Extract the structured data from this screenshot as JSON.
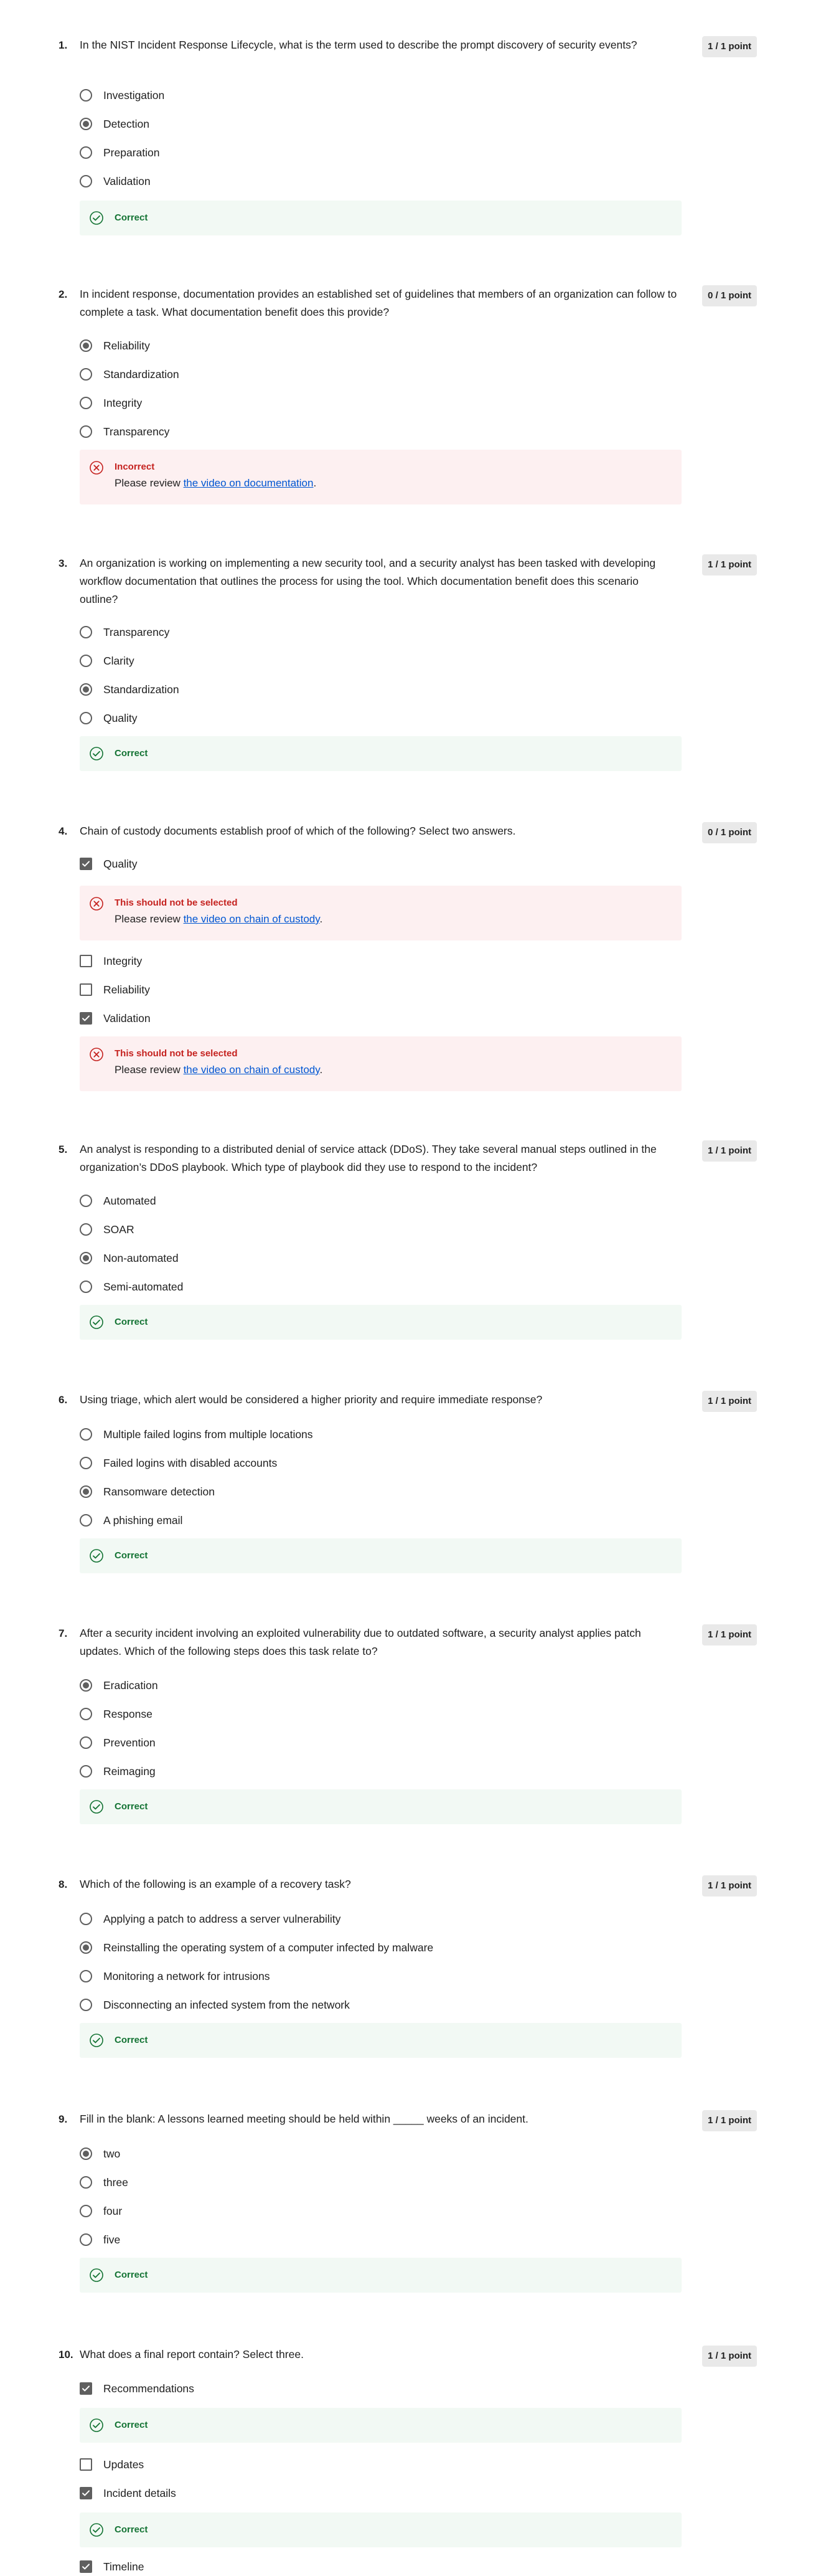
{
  "icons": {
    "correct": "check-circle-icon",
    "incorrect": "x-circle-icon",
    "radio_selected": "radio-selected-icon",
    "radio_unselected": "radio-unselected-icon",
    "checkbox_checked": "checkbox-checked-icon",
    "checkbox_unchecked": "checkbox-unchecked-icon"
  },
  "colors": {
    "correct_text": "#137333",
    "correct_bg": "#f2f9f4",
    "incorrect_text": "#c5221f",
    "incorrect_bg": "#fdf0f1",
    "link": "#0056d2",
    "points_badge_bg": "#e9e9e9"
  },
  "questions": [
    {
      "number": "1.",
      "text": "In the NIST Incident Response Lifecycle, what is the term used to describe the prompt discovery of security events?",
      "points": "1 / 1 point",
      "options": [
        {
          "label": "Investigation",
          "selected": false
        },
        {
          "label": "Detection",
          "selected": true
        },
        {
          "label": "Preparation",
          "selected": false
        },
        {
          "label": "Validation",
          "selected": false
        }
      ],
      "feedback": {
        "title": "Correct"
      }
    },
    {
      "number": "2.",
      "text": "In incident response, documentation provides an established set of guidelines that members of an organization can follow to complete a task. What documentation benefit does this provide?",
      "points": "0 / 1 point",
      "options": [
        {
          "label": "Reliability",
          "selected": true
        },
        {
          "label": "Standardization",
          "selected": false
        },
        {
          "label": "Integrity",
          "selected": false
        },
        {
          "label": "Transparency",
          "selected": false
        }
      ],
      "feedback": {
        "title": "Incorrect",
        "body_prefix": "Please review ",
        "link_text": "the video on documentation",
        "body_suffix": "."
      }
    },
    {
      "number": "3.",
      "text": "An organization is working on implementing a new security tool, and a security analyst has been tasked with developing workflow documentation that outlines the process for using the tool. Which documentation benefit does this scenario outline?",
      "points": "1 / 1 point",
      "options": [
        {
          "label": "Transparency",
          "selected": false
        },
        {
          "label": "Clarity",
          "selected": false
        },
        {
          "label": "Standardization",
          "selected": true
        },
        {
          "label": "Quality",
          "selected": false
        }
      ],
      "feedback": {
        "title": "Correct"
      }
    },
    {
      "number": "4.",
      "text": "Chain of custody documents establish proof of which of the following? Select two answers.",
      "points": "0 / 1 point",
      "options": [
        {
          "label": "Quality",
          "checked": true,
          "feedback": {
            "title": "This should not be selected",
            "body_prefix": "Please review ",
            "link_text": "the video on chain of custody",
            "body_suffix": "."
          }
        },
        {
          "label": "Integrity",
          "checked": false
        },
        {
          "label": "Reliability",
          "checked": false
        },
        {
          "label": "Validation",
          "checked": true,
          "feedback": {
            "title": "This should not be selected",
            "body_prefix": "Please review ",
            "link_text": "the video on chain of custody",
            "body_suffix": "."
          }
        }
      ]
    },
    {
      "number": "5.",
      "text": "An analyst is responding to a distributed denial of service attack (DDoS). They take several manual steps outlined in the organization’s DDoS playbook. Which type of playbook did they use to respond to the incident?",
      "points": "1 / 1 point",
      "options": [
        {
          "label": "Automated",
          "selected": false
        },
        {
          "label": "SOAR",
          "selected": false
        },
        {
          "label": "Non-automated",
          "selected": true
        },
        {
          "label": "Semi-automated",
          "selected": false
        }
      ],
      "feedback": {
        "title": "Correct"
      }
    },
    {
      "number": "6.",
      "text": "Using triage, which alert would be considered a higher priority and require immediate response?",
      "points": "1 / 1 point",
      "options": [
        {
          "label": "Multiple failed logins from multiple locations",
          "selected": false
        },
        {
          "label": "Failed logins with disabled accounts",
          "selected": false
        },
        {
          "label": "Ransomware detection",
          "selected": true
        },
        {
          "label": "A phishing email",
          "selected": false
        }
      ],
      "feedback": {
        "title": "Correct"
      }
    },
    {
      "number": "7.",
      "text": "After a security incident involving an exploited vulnerability due to outdated software, a security analyst applies patch updates. Which of the following steps does this task relate to?",
      "points": "1 / 1 point",
      "options": [
        {
          "label": "Eradication",
          "selected": true
        },
        {
          "label": "Response",
          "selected": false
        },
        {
          "label": "Prevention",
          "selected": false
        },
        {
          "label": "Reimaging",
          "selected": false
        }
      ],
      "feedback": {
        "title": "Correct"
      }
    },
    {
      "number": "8.",
      "text": "Which of the following is an example of a recovery task?",
      "points": "1 / 1 point",
      "options": [
        {
          "label": "Applying a patch to address a server vulnerability",
          "selected": false
        },
        {
          "label": "Reinstalling the operating system of a computer infected by malware",
          "selected": true
        },
        {
          "label": "Monitoring a network for intrusions",
          "selected": false
        },
        {
          "label": "Disconnecting an infected system from the network",
          "selected": false
        }
      ],
      "feedback": {
        "title": "Correct"
      }
    },
    {
      "number": "9.",
      "text": "Fill in the blank: A lessons learned meeting should be held within _____ weeks of an incident.",
      "points": "1 / 1 point",
      "options": [
        {
          "label": "two",
          "selected": true
        },
        {
          "label": "three",
          "selected": false
        },
        {
          "label": "four",
          "selected": false
        },
        {
          "label": "five",
          "selected": false
        }
      ],
      "feedback": {
        "title": "Correct"
      }
    },
    {
      "number": "10.",
      "text": "What does a final report contain? Select three.",
      "points": "1 / 1 point",
      "options": [
        {
          "label": "Recommendations",
          "checked": true,
          "feedback": {
            "title": "Correct"
          }
        },
        {
          "label": "Updates",
          "checked": false
        },
        {
          "label": "Incident details",
          "checked": true,
          "feedback": {
            "title": "Correct"
          }
        },
        {
          "label": "Timeline",
          "checked": true
        }
      ]
    }
  ]
}
